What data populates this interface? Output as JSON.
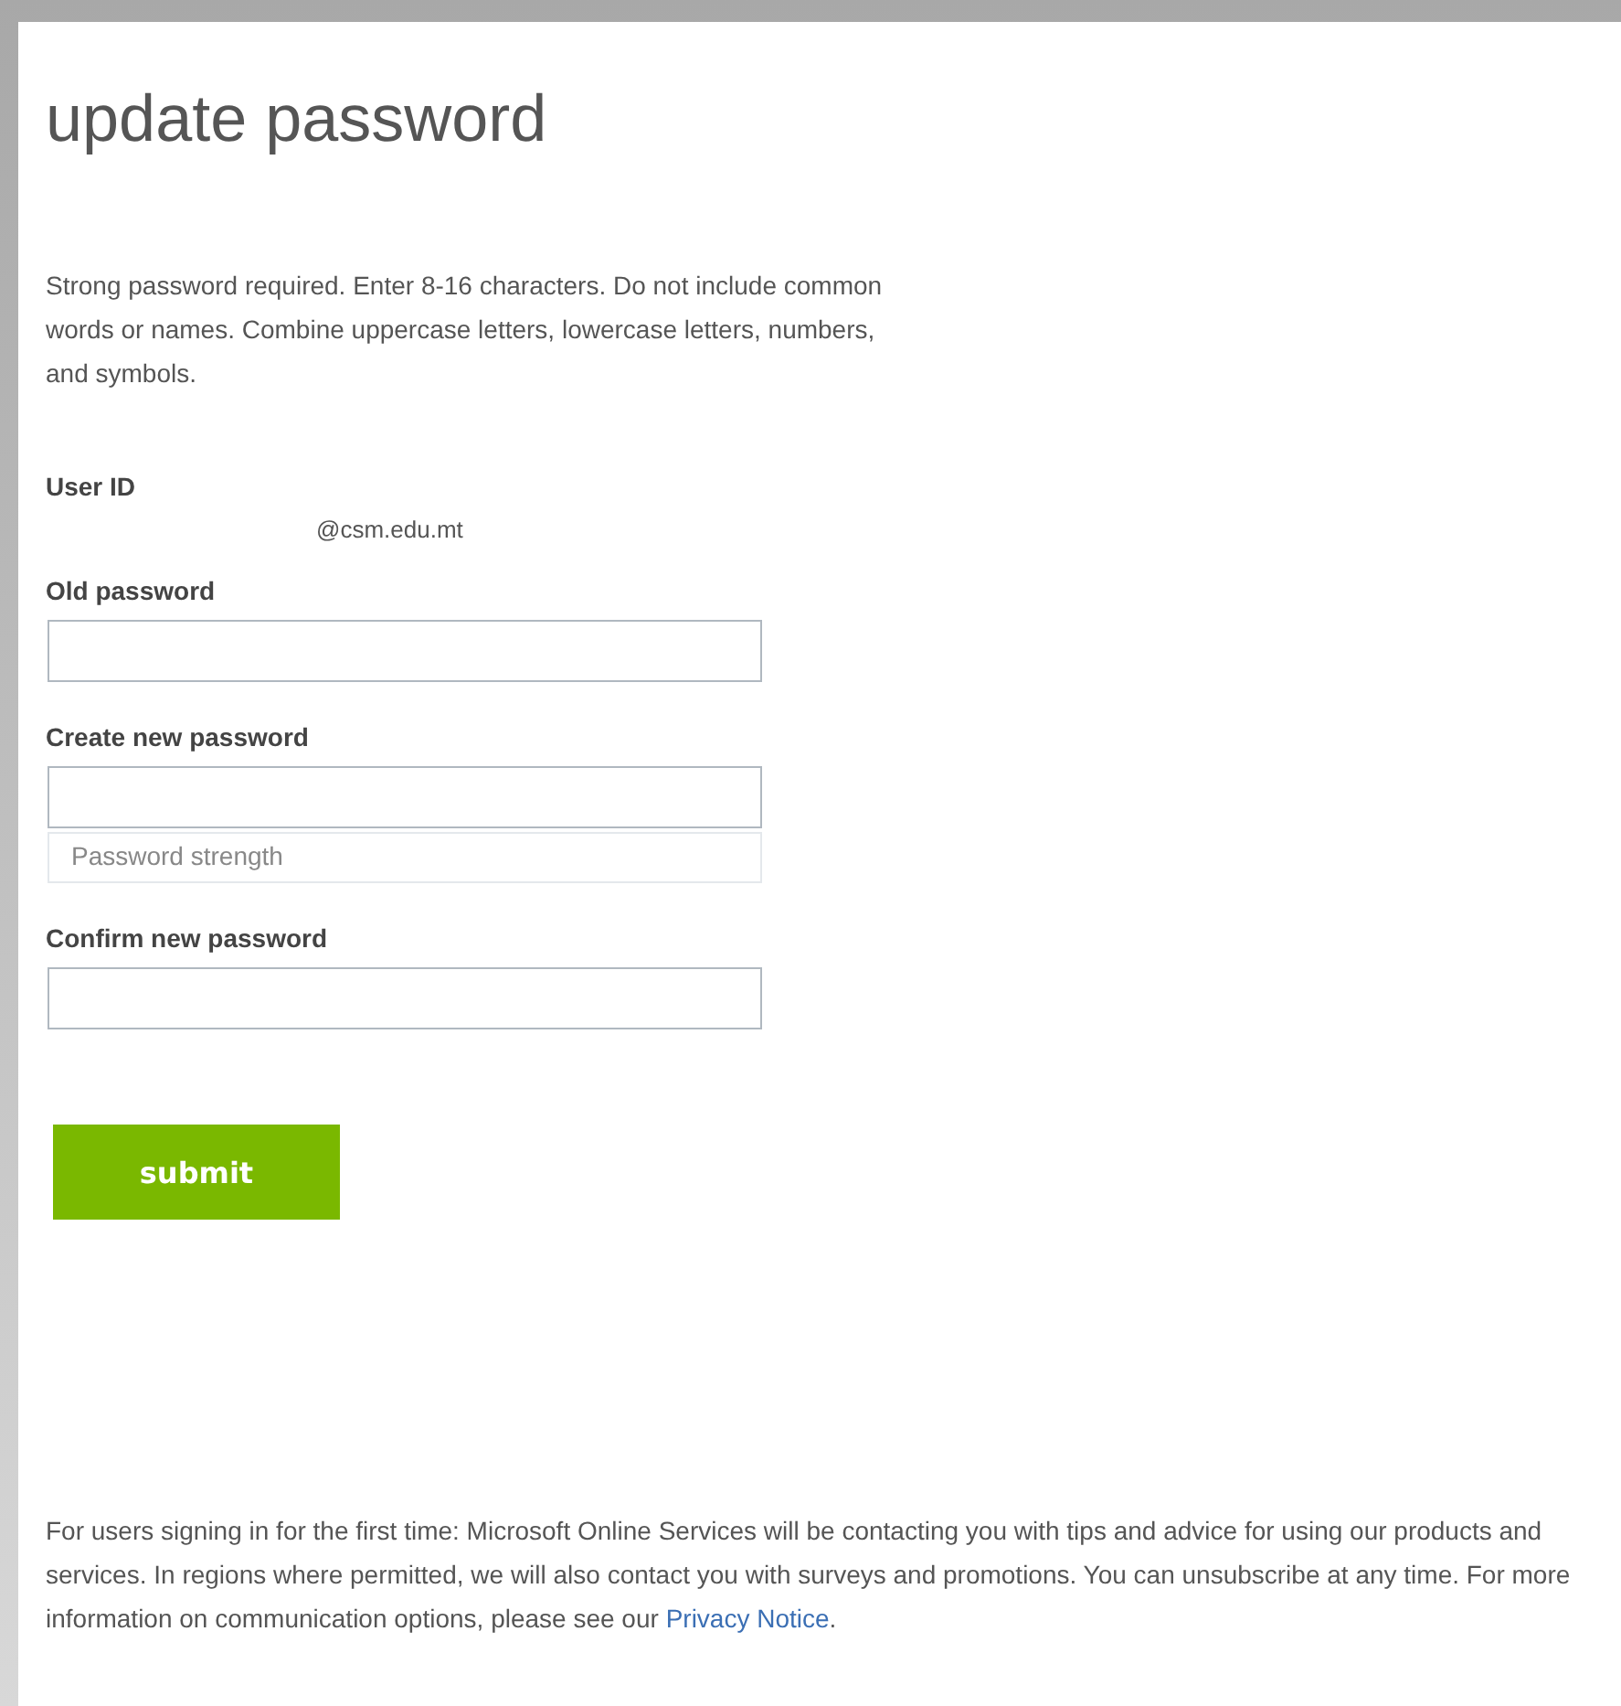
{
  "title": "update password",
  "intro": "Strong password required. Enter 8-16 characters. Do not include common words or names. Combine uppercase letters, lowercase letters, numbers, and symbols.",
  "user_id": {
    "label": "User ID",
    "value": "@csm.edu.mt"
  },
  "fields": [
    {
      "label": "Old password"
    },
    {
      "label": "Create new password",
      "strength": "Password strength"
    },
    {
      "label": "Confirm new password"
    }
  ],
  "submit": "submit",
  "footer": {
    "text": "For users signing in for the first time: Microsoft Online Services will be contacting you with tips and advice for using our products and services. In regions where permitted, we will also contact you with surveys and promotions. You can unsubscribe at any time. For more information on communication options, please see our ",
    "link": "Privacy Notice",
    "end": "."
  }
}
